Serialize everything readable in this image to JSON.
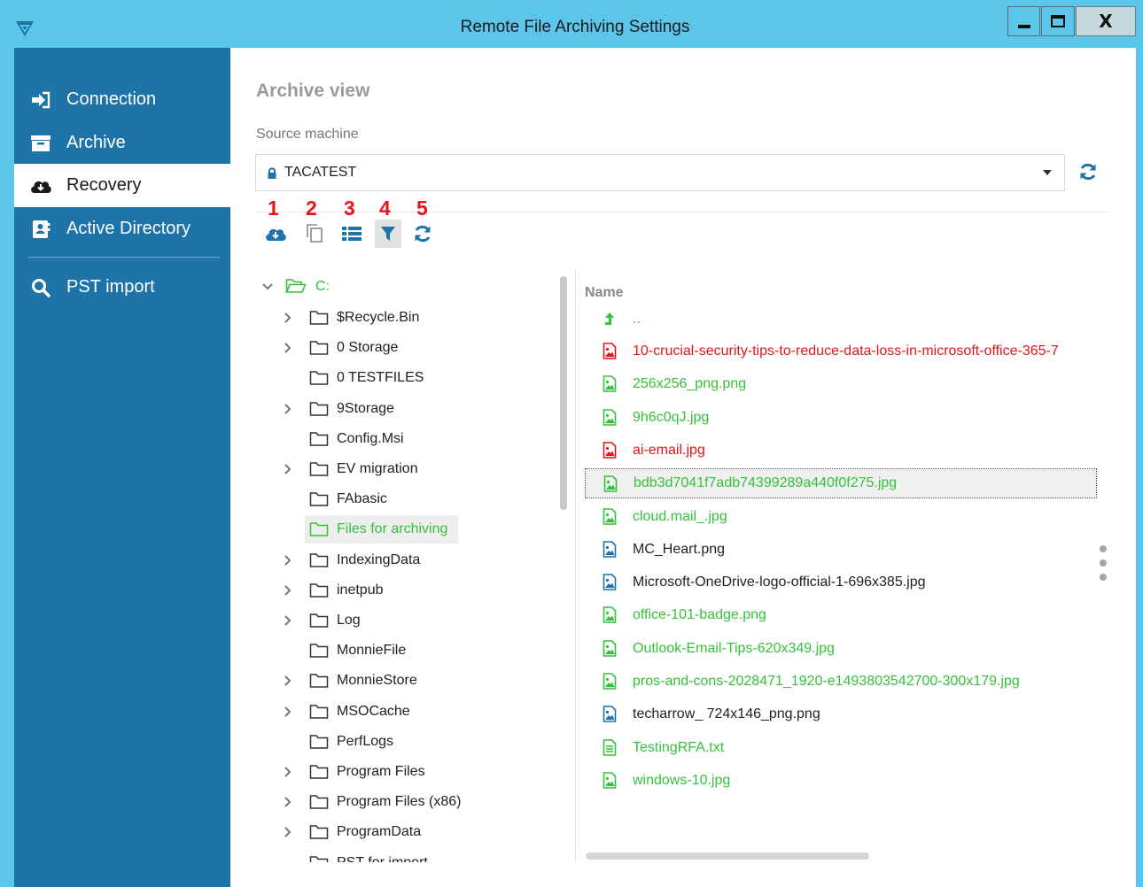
{
  "window": {
    "title": "Remote File Archiving Settings",
    "minimize_label": "",
    "maximize_label": "",
    "close_label": "X"
  },
  "sidebar": {
    "items": [
      {
        "label": "Connection",
        "icon": "sign-in-icon",
        "active": false
      },
      {
        "label": "Archive",
        "icon": "archive-box-icon",
        "active": false
      },
      {
        "label": "Recovery",
        "icon": "cloud-download-icon",
        "active": true
      },
      {
        "label": "Active Directory",
        "icon": "address-book-icon",
        "active": false
      },
      {
        "label": "PST import",
        "icon": "search-icon",
        "active": false
      }
    ]
  },
  "main": {
    "title": "Archive view",
    "source_label": "Source machine",
    "source_value": "TACATEST",
    "toolbar_numbers": [
      "1",
      "2",
      "3",
      "4",
      "5"
    ],
    "toolbar": [
      {
        "icon": "cloud-download-icon"
      },
      {
        "icon": "copy-icon"
      },
      {
        "icon": "list-view-icon"
      },
      {
        "icon": "filter-icon",
        "pressed": true
      },
      {
        "icon": "refresh-icon"
      }
    ]
  },
  "tree": {
    "root": "C:",
    "folders": [
      {
        "name": "$Recycle.Bin",
        "expandable": true
      },
      {
        "name": "0 Storage",
        "expandable": true
      },
      {
        "name": "0 TESTFILES",
        "expandable": false
      },
      {
        "name": "9Storage",
        "expandable": true
      },
      {
        "name": "Config.Msi",
        "expandable": false
      },
      {
        "name": "EV migration",
        "expandable": true
      },
      {
        "name": "FAbasic",
        "expandable": false
      },
      {
        "name": "Files for archiving",
        "expandable": false,
        "selected": true
      },
      {
        "name": "IndexingData",
        "expandable": true
      },
      {
        "name": "inetpub",
        "expandable": true
      },
      {
        "name": "Log",
        "expandable": true
      },
      {
        "name": "MonnieFile",
        "expandable": false
      },
      {
        "name": "MonnieStore",
        "expandable": true
      },
      {
        "name": "MSOCache",
        "expandable": true
      },
      {
        "name": "PerfLogs",
        "expandable": false
      },
      {
        "name": "Program Files",
        "expandable": true
      },
      {
        "name": "Program Files (x86)",
        "expandable": true
      },
      {
        "name": "ProgramData",
        "expandable": true
      },
      {
        "name": "PST for import",
        "expandable": false
      }
    ]
  },
  "files": {
    "header": "Name",
    "parent": "..",
    "items": [
      {
        "name": "10-crucial-security-tips-to-reduce-data-loss-in-microsoft-office-365-7",
        "status": "red",
        "type": "image"
      },
      {
        "name": "256x256_png.png",
        "status": "green",
        "type": "image"
      },
      {
        "name": "9h6c0qJ.jpg",
        "status": "green",
        "type": "image"
      },
      {
        "name": "ai-email.jpg",
        "status": "red",
        "type": "image"
      },
      {
        "name": "bdb3d7041f7adb74399289a440f0f275.jpg",
        "status": "green",
        "type": "image",
        "selected": true
      },
      {
        "name": "cloud.mail_.jpg",
        "status": "green",
        "type": "image"
      },
      {
        "name": "MC_Heart.png",
        "status": "dark",
        "type": "image"
      },
      {
        "name": "Microsoft-OneDrive-logo-official-1-696x385.jpg",
        "status": "dark",
        "type": "image"
      },
      {
        "name": "office-101-badge.png",
        "status": "green",
        "type": "image"
      },
      {
        "name": "Outlook-Email-Tips-620x349.jpg",
        "status": "green",
        "type": "image"
      },
      {
        "name": "pros-and-cons-2028471_1920-e1493803542700-300x179.jpg",
        "status": "green",
        "type": "image"
      },
      {
        "name": "techarrow_ 724x146_png.png",
        "status": "dark",
        "type": "image"
      },
      {
        "name": "TestingRFA.txt",
        "status": "green",
        "type": "text"
      },
      {
        "name": "windows-10.jpg",
        "status": "green",
        "type": "image"
      }
    ]
  },
  "colors": {
    "titlebar": "#5cc6ea",
    "sidebar": "#1e73a8",
    "archived_green": "#35c13a",
    "error_red": "#e8141c",
    "icon_blue": "#1e73a8",
    "annotation_red": "#e8141c"
  }
}
